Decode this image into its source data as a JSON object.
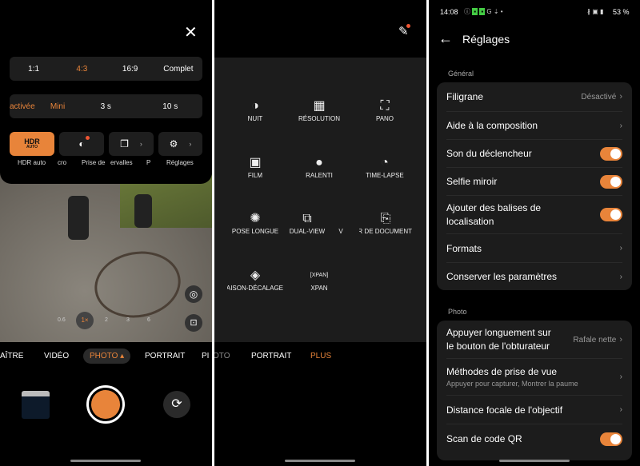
{
  "left": {
    "close_icon": "close-icon",
    "ratios": [
      "1:1",
      "4:3",
      "16:9",
      "Complet"
    ],
    "ratio_selected": "4:3",
    "timer": [
      "activée",
      "Mini",
      "3 s",
      "10 s"
    ],
    "tiles": [
      {
        "icon": "hdr-auto-icon",
        "label": "HDR auto",
        "text": "HDR",
        "sub": "AUTO"
      },
      {
        "icon": "macro-icon",
        "label_left": "cro",
        "label": "Prise de"
      },
      {
        "icon": "burst-icon",
        "label": "ervalles"
      },
      {
        "icon": "settings-icon",
        "label_left": "P",
        "label": "Réglages"
      }
    ],
    "zoom": [
      "0.6",
      "1×",
      "2",
      "3",
      "6"
    ],
    "modes": [
      "AÎTRE",
      "VIDÉO",
      "PHOTO",
      "PORTRAIT",
      "PI"
    ],
    "active_mode": "PHOTO"
  },
  "middle": {
    "items": [
      {
        "label": "NUIT",
        "icon": "night-icon"
      },
      {
        "label": "RÉSOLUTION",
        "icon": "high-resolution-icon"
      },
      {
        "label": "PANO",
        "icon": "panorama-icon"
      },
      {
        "label": "FILM",
        "icon": "film-icon"
      },
      {
        "label": "RALENTI",
        "icon": "slow-motion-icon"
      },
      {
        "label": "TIME-LAPSE",
        "icon": "time-lapse-icon"
      },
      {
        "label": "POSE LONGUE",
        "icon": "long-exposure-icon"
      },
      {
        "label": "DUAL-VIEW",
        "icon": "dual-view-icon"
      },
      {
        "label": "SCANNER DE DOCUMENT",
        "icon": "document-scan-icon"
      },
      {
        "label": "INCLINAISON-DÉCALAGE",
        "icon": "tilt-shift-icon"
      },
      {
        "label": "XPAN",
        "icon": "xpan-icon"
      }
    ],
    "stray_v": "V",
    "modes": [
      "OTO",
      "PORTRAIT",
      "PLUS"
    ],
    "active_mode": "PLUS"
  },
  "right": {
    "status": {
      "time": "14:08",
      "battery": "53 %"
    },
    "title": "Réglages",
    "general_label": "Général",
    "general": [
      {
        "label": "Filigrane",
        "value": "Désactivé",
        "type": "link"
      },
      {
        "label": "Aide à la composition",
        "type": "link"
      },
      {
        "label": "Son du déclencheur",
        "type": "toggle",
        "on": true
      },
      {
        "label": "Selfie miroir",
        "type": "toggle",
        "on": true
      },
      {
        "label": "Ajouter des balises de localisation",
        "type": "toggle",
        "on": true
      },
      {
        "label": "Formats",
        "type": "link"
      },
      {
        "label": "Conserver les paramètres",
        "type": "link"
      }
    ],
    "photo_label": "Photo",
    "photo": [
      {
        "label": "Appuyer longuement sur le bouton de l'obturateur",
        "value": "Rafale nette",
        "type": "link"
      },
      {
        "label": "Méthodes de prise de vue",
        "sub": "Appuyer pour capturer, Montrer la paume",
        "type": "link"
      },
      {
        "label": "Distance focale de l'objectif",
        "type": "link"
      },
      {
        "label": "Scan de code QR",
        "type": "toggle",
        "on": true
      }
    ]
  },
  "colors": {
    "accent": "#e8843a",
    "card": "#1c1c1c"
  }
}
